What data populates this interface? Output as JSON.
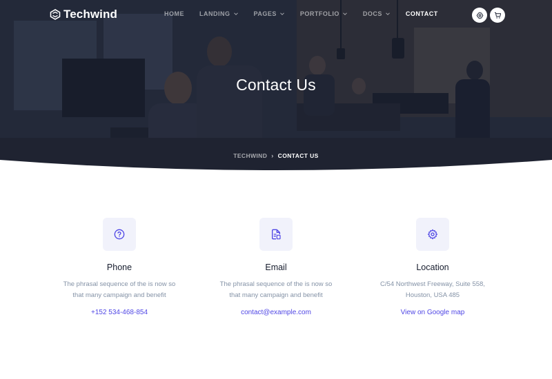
{
  "brand": {
    "name": "Techwind",
    "logo_icon": "techwind-logo-icon"
  },
  "nav": {
    "items": [
      {
        "label": "HOME",
        "dropdown": false
      },
      {
        "label": "LANDING",
        "dropdown": true
      },
      {
        "label": "PAGES",
        "dropdown": true
      },
      {
        "label": "PORTFOLIO",
        "dropdown": true
      },
      {
        "label": "DOCS",
        "dropdown": true
      },
      {
        "label": "CONTACT",
        "dropdown": false,
        "active": true
      }
    ],
    "settings_icon": "gear-icon",
    "cart_icon": "cart-icon"
  },
  "hero": {
    "title": "Contact Us",
    "breadcrumb": {
      "parent": "TECHWIND",
      "separator": "›",
      "current": "CONTACT US"
    }
  },
  "contact_cards": [
    {
      "icon": "help-circle-icon",
      "title": "Phone",
      "desc_line1": "The phrasal sequence of the is now so",
      "desc_line2": "that many campaign and benefit",
      "link": "+152 534-468-854"
    },
    {
      "icon": "document-icon",
      "title": "Email",
      "desc_line1": "The phrasal sequence of the is now so",
      "desc_line2": "that many campaign and benefit",
      "link": "contact@example.com"
    },
    {
      "icon": "settings-icon",
      "title": "Location",
      "desc_line1": "C/54 Northwest Freeway, Suite 558,",
      "desc_line2": "Houston, USA 485",
      "link": "View on Google map"
    }
  ],
  "colors": {
    "accent": "#4f46e5",
    "text_muted": "#8492a6",
    "icon_bg": "#f1f2fb",
    "heading": "#161c2d"
  }
}
